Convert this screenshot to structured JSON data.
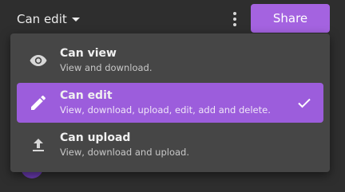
{
  "toolbar": {
    "permission_label": "Can edit",
    "more_icon": "more-vertical-icon",
    "share_label": "Share"
  },
  "menu": {
    "items": [
      {
        "title": "Can view",
        "description": "View and download.",
        "icon": "eye-icon",
        "selected": false
      },
      {
        "title": "Can edit",
        "description": "View, download, upload, edit, add and delete.",
        "icon": "pencil-icon",
        "selected": true
      },
      {
        "title": "Can upload",
        "description": "View, download and upload.",
        "icon": "upload-icon",
        "selected": false
      }
    ],
    "selected_check_icon": "check-icon"
  },
  "colors": {
    "background": "#2e2e2e",
    "menu_background": "#464646",
    "accent": "#a463e0",
    "selected_item": "#9c5ddc",
    "text": "#ececec"
  }
}
